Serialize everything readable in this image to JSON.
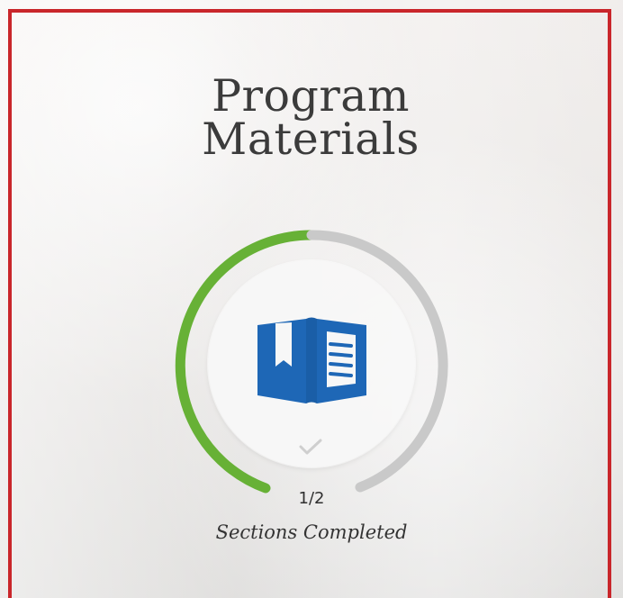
{
  "page": {
    "title": "Program\nMaterials"
  },
  "progress": {
    "completed": 1,
    "total": 2,
    "count_label": "1/2",
    "status_label": "Sections Completed",
    "percent": 0.5
  },
  "icons": {
    "book": "book-icon",
    "check": "check-icon"
  },
  "colors": {
    "border": "#c9262b",
    "progress": "#67b136",
    "track": "#c9c9c9",
    "book": "#1e67b6"
  }
}
